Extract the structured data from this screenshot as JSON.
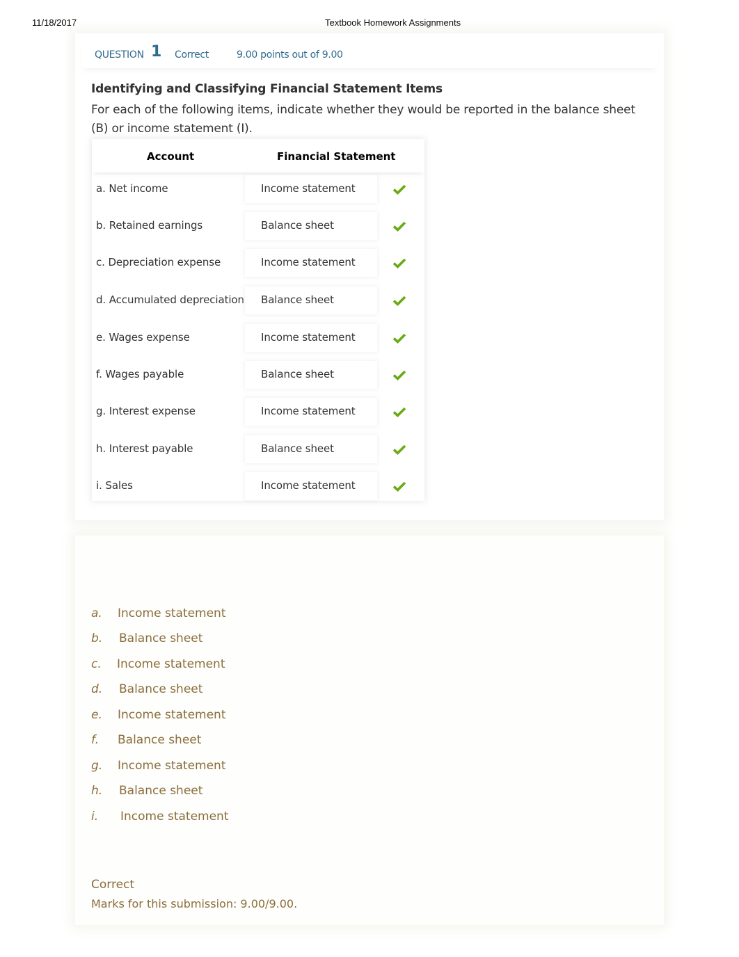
{
  "print_header": {
    "date": "11/18/2017",
    "title": "Textbook Homework Assignments"
  },
  "question": {
    "label": "QUESTION",
    "number": "1",
    "status": "Correct",
    "points": "9.00 points out of 9.00",
    "title": "Identifying and Classifying Financial Statement Items",
    "instructions": "For each of the following items, indicate whether they would be reported in the balance sheet (B) or income statement (I).",
    "table": {
      "headers": [
        "Account",
        "Financial Statement"
      ],
      "rows": [
        {
          "account": "a. Net income",
          "statement": "Income statement",
          "result": "correct"
        },
        {
          "account": "b. Retained earnings",
          "statement": "Balance sheet",
          "result": "correct"
        },
        {
          "account": "c. Depreciation expense",
          "statement": "Income statement",
          "result": "correct"
        },
        {
          "account": "d. Accumulated depreciation",
          "statement": "Balance sheet",
          "result": "correct"
        },
        {
          "account": "e. Wages expense",
          "statement": "Income statement",
          "result": "correct"
        },
        {
          "account": "f. Wages payable",
          "statement": "Balance sheet",
          "result": "correct"
        },
        {
          "account": "g. Interest expense",
          "statement": "Income statement",
          "result": "correct"
        },
        {
          "account": "h. Interest payable",
          "statement": "Balance sheet",
          "result": "correct"
        },
        {
          "account": "i. Sales",
          "statement": "Income statement",
          "result": "correct"
        }
      ]
    }
  },
  "answer_key": {
    "items": [
      {
        "letter": "a.",
        "value": "Income statement"
      },
      {
        "letter": "b.",
        "value": "Balance sheet"
      },
      {
        "letter": "c.",
        "value": "Income statement"
      },
      {
        "letter": "d.",
        "value": "Balance sheet"
      },
      {
        "letter": "e.",
        "value": "Income statement"
      },
      {
        "letter": "f.",
        "value": "Balance sheet"
      },
      {
        "letter": "g.",
        "value": "Income statement"
      },
      {
        "letter": "h.",
        "value": "Balance sheet"
      },
      {
        "letter": "i.",
        "value": "Income statement"
      }
    ],
    "feedback_status": "Correct",
    "feedback_marks": "Marks for this submission: 9.00/9.00."
  },
  "colors": {
    "header_blue": "#2f6b8f",
    "check_green": "#6aaa12",
    "answer_brown": "#8a6d3b"
  },
  "icons": {
    "row_result": "checkmark-icon"
  }
}
